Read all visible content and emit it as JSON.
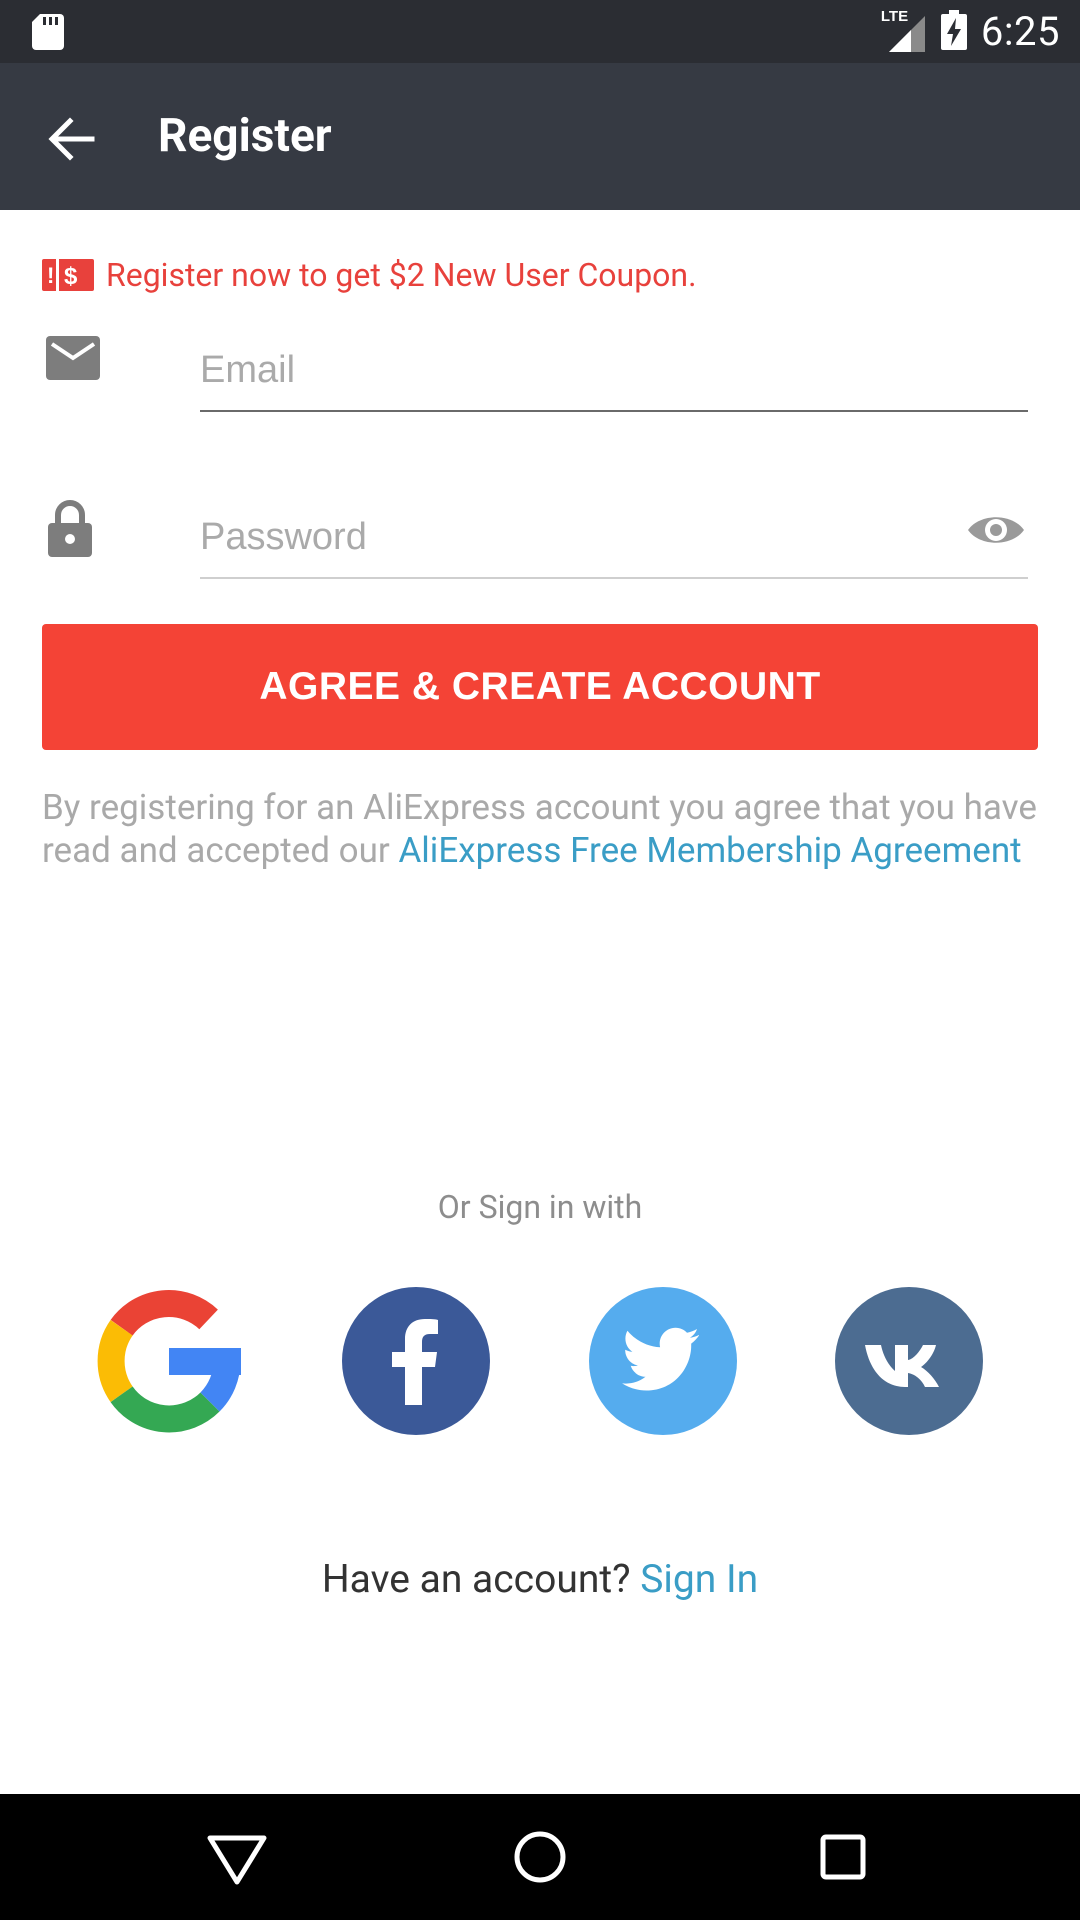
{
  "status_bar": {
    "time": "6:25",
    "network_label": "LTE",
    "icons": [
      "sd-card-icon",
      "lte-signal-icon",
      "battery-charging-icon"
    ]
  },
  "app_bar": {
    "title": "Register",
    "back_icon": "arrow-back-icon"
  },
  "promo": {
    "text": "Register now to get $2 New User Coupon.",
    "icon": "coupon-icon",
    "color": "#e8413c"
  },
  "form": {
    "email": {
      "placeholder": "Email",
      "value": "",
      "icon": "mail-icon"
    },
    "password": {
      "placeholder": "Password",
      "value": "",
      "icon": "lock-icon",
      "toggle_icon": "eye-icon"
    },
    "submit_label": "AGREE & CREATE ACCOUNT",
    "submit_color": "#f44336"
  },
  "terms": {
    "prefix": "By registering for an AliExpress account you agree that you have read and accepted our ",
    "link_text": "AliExpress Free Membership Agreement"
  },
  "social": {
    "heading": "Or Sign in with",
    "providers": [
      {
        "name": "Google",
        "icon": "google-icon"
      },
      {
        "name": "Facebook",
        "icon": "facebook-icon",
        "color": "#3b5998"
      },
      {
        "name": "Twitter",
        "icon": "twitter-icon",
        "color": "#55acee"
      },
      {
        "name": "VK",
        "icon": "vk-icon",
        "color": "#4c6c91"
      }
    ]
  },
  "signin": {
    "prompt": "Have an account? ",
    "link_text": "Sign In"
  },
  "nav_bar": {
    "icons": [
      "nav-back-icon",
      "nav-home-icon",
      "nav-recents-icon"
    ]
  }
}
